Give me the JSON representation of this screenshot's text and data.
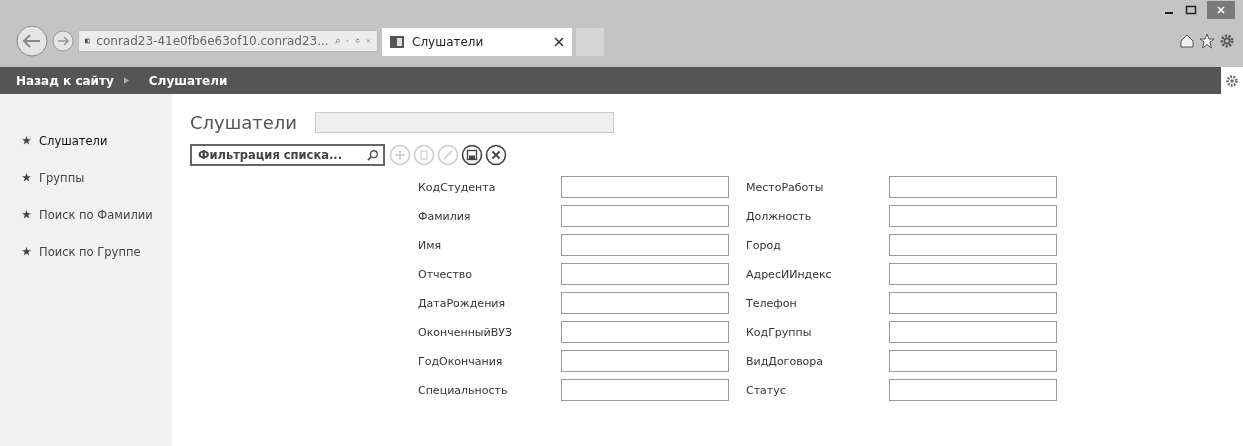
{
  "browser": {
    "address": "conrad23-41e0fb6e63of10.conrad23...",
    "tab": {
      "title": "Слушатели",
      "selected": true
    }
  },
  "nav": {
    "back": "Назад к сайту",
    "current": "Слушатели"
  },
  "sidebar": {
    "items": [
      {
        "label": "Слушатели",
        "selected": true
      },
      {
        "label": "Группы",
        "selected": false
      },
      {
        "label": "Поиск по Фамилии",
        "selected": false
      },
      {
        "label": "Поиск по Группе",
        "selected": false
      }
    ]
  },
  "page": {
    "title": "Слушатели"
  },
  "search": {
    "placeholder": "Фильтрация списка..."
  },
  "toolbar": [
    {
      "kind": "add",
      "disabled": true
    },
    {
      "kind": "delete",
      "disabled": true
    },
    {
      "kind": "edit",
      "disabled": true
    },
    {
      "kind": "save",
      "disabled": false
    },
    {
      "kind": "cancel",
      "disabled": false
    }
  ],
  "form": {
    "left": [
      "КодСтудента",
      "Фамилия",
      "Имя",
      "Отчество",
      "ДатаРождения",
      "ОконченныйВУЗ",
      "ГодОкончания",
      "Специальность"
    ],
    "right": [
      "МестоРаботы",
      "Должность",
      "Город",
      "АдресИИндекс",
      "Телефон",
      "КодГруппы",
      "ВидДоговора",
      "Статус"
    ]
  }
}
